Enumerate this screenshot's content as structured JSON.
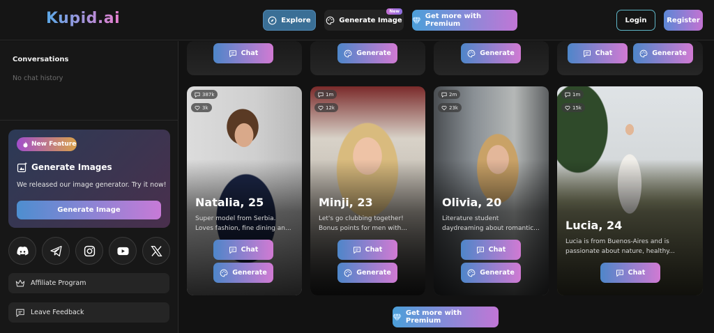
{
  "header": {
    "logo": "Kupid.ai",
    "explore": "Explore",
    "generate_image": "Generate Image",
    "new_badge": "New",
    "premium": "Get more with Premium",
    "login": "Login",
    "register": "Register"
  },
  "sidebar": {
    "conversations_title": "Conversations",
    "no_history": "No chat history",
    "feature": {
      "badge": "New Feature",
      "title": "Generate Images",
      "text": "We released our image generator. Try it now!",
      "button": "Generate Image"
    },
    "socials": [
      "discord-icon",
      "telegram-icon",
      "instagram-icon",
      "youtube-icon",
      "x-icon"
    ],
    "affiliate": "Affiliate Program",
    "feedback": "Leave Feedback"
  },
  "top_row": {
    "chat": "Chat",
    "generate": "Generate"
  },
  "cards": [
    {
      "name": "Natalia, 25",
      "desc1": "Super model from Serbia.",
      "desc2": "Loves fashion, fine dining an...",
      "messages": "387k",
      "likes": "3k",
      "chat": "Chat",
      "generate": "Generate"
    },
    {
      "name": "Minji, 23",
      "desc1": "Let's go clubbing together!",
      "desc2": "Bonus points for men with...",
      "messages": "1m",
      "likes": "12k",
      "chat": "Chat",
      "generate": "Generate"
    },
    {
      "name": "Olivia, 20",
      "desc1": "Literature student",
      "desc2": "daydreaming about romantic...",
      "messages": "2m",
      "likes": "23k",
      "chat": "Chat",
      "generate": "Generate"
    },
    {
      "name": "Lucia, 24",
      "desc1": "Lucia is from Buenos-Aires and is",
      "desc2": "passionate about nature, healthy...",
      "messages": "1m",
      "likes": "15k",
      "chat": "Chat"
    }
  ],
  "bottom_premium": "Get more with Premium",
  "colors": {
    "accent_blue": "#4e86c9",
    "accent_pink": "#d17ad3",
    "background": "#121212"
  }
}
